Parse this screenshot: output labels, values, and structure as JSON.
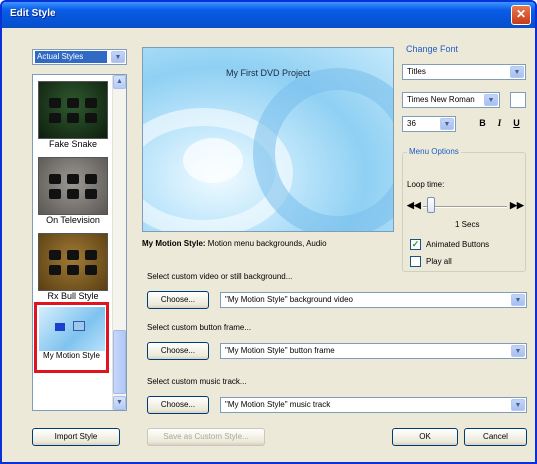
{
  "window": {
    "title": "Edit Style",
    "close": "✕"
  },
  "style_category": {
    "value": "Actual Styles",
    "arrow": "▼"
  },
  "styles": [
    {
      "caption": "Fake Snake",
      "theme": "green"
    },
    {
      "caption": "On Television",
      "theme": "tv"
    },
    {
      "caption": "Rx Bull Style",
      "theme": "bull"
    },
    {
      "caption": "My Motion Style",
      "theme": "motion",
      "selected": true
    }
  ],
  "scroll_up": "▲",
  "scroll_down": "▼",
  "preview": {
    "title": "My First DVD Project"
  },
  "description": {
    "bold": "My Motion Style:",
    "text": " Motion menu backgrounds, Audio"
  },
  "background": {
    "label": "Select custom video or still background...",
    "choose": "Choose...",
    "value": "\"My Motion Style\" background video"
  },
  "button_frame": {
    "label": "Select custom button frame...",
    "choose": "Choose...",
    "value": "\"My Motion Style\" button frame"
  },
  "music": {
    "label": "Select custom music track...",
    "choose": "Choose...",
    "value": "\"My Motion Style\" music track"
  },
  "font": {
    "title": "Change Font",
    "target": "Titles",
    "family": "Times New Roman",
    "size": "36",
    "bold": "B",
    "italic": "I",
    "underline": "U"
  },
  "menu_options": {
    "title": "Menu Options",
    "loop_label": "Loop time:",
    "rewind": "◀◀",
    "forward": "▶▶",
    "loop_value": "1 Secs",
    "loop_level": 0.1,
    "animated_buttons": "Animated Buttons",
    "animated_checked": true,
    "play_all": "Play all",
    "play_all_checked": false
  },
  "footer": {
    "import": "Import Style",
    "save": "Save as Custom Style...",
    "ok": "OK",
    "cancel": "Cancel"
  }
}
